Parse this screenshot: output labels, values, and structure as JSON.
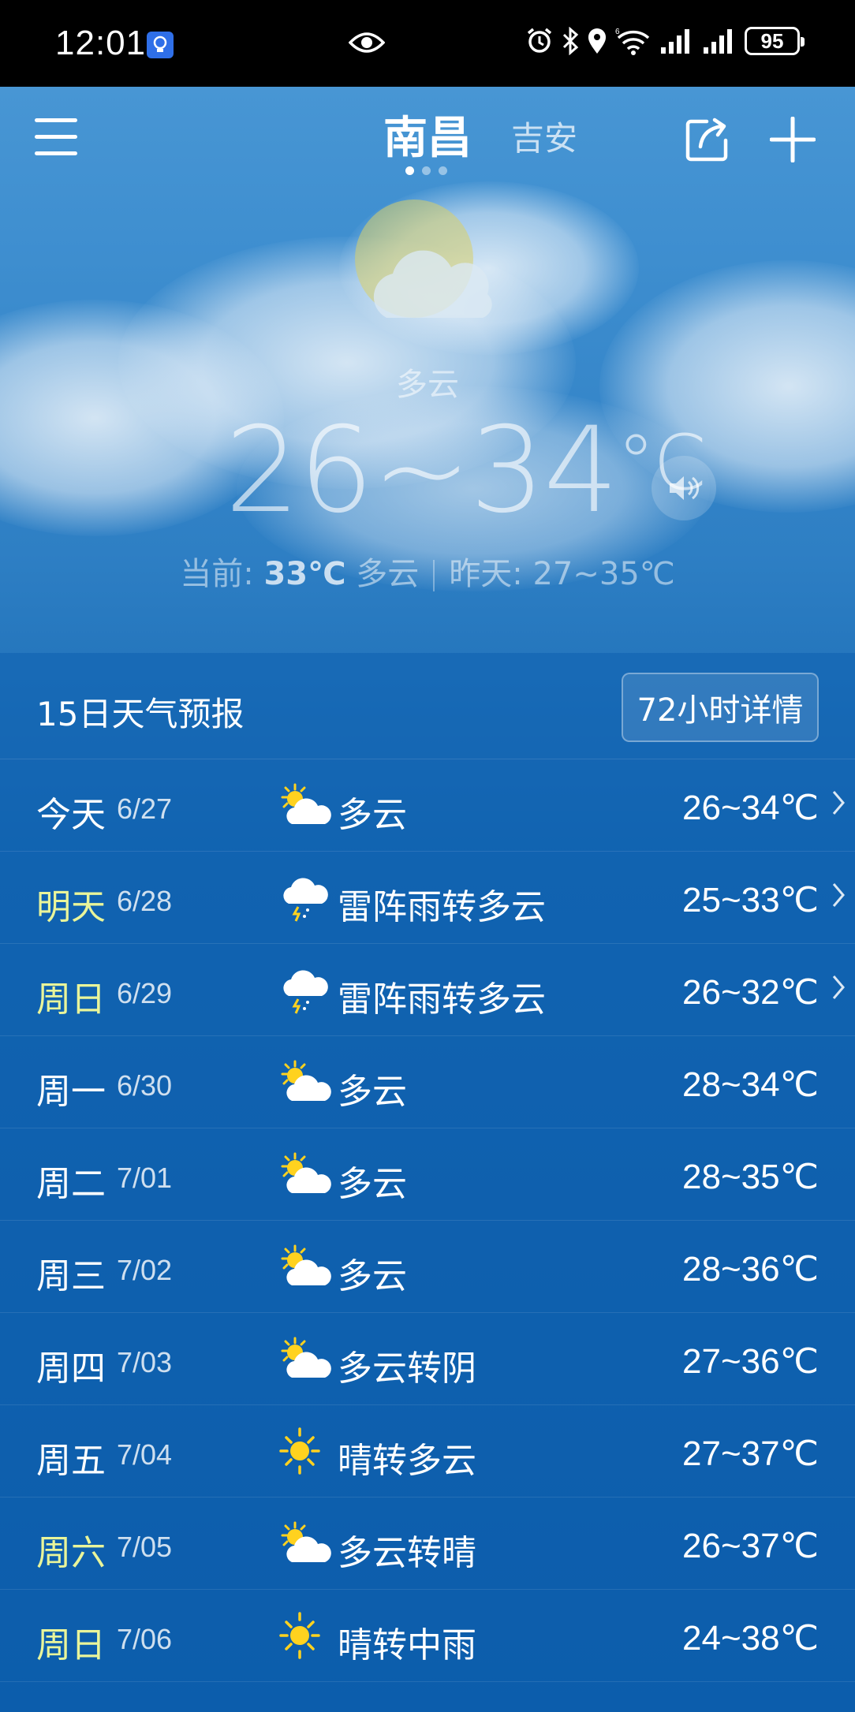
{
  "status_bar": {
    "time": "12:01",
    "battery": "95",
    "icons": [
      "bulb-icon",
      "eye-icon",
      "alarm-icon",
      "bluetooth-icon",
      "location-icon",
      "wifi-icon",
      "signal-icon",
      "signal-icon",
      "battery-icon"
    ]
  },
  "nav": {
    "city_current": "南昌",
    "city_other": "吉安",
    "page_dots": 3,
    "active_dot": 0
  },
  "current": {
    "condition": "多云",
    "temp_range": "26~34",
    "unit": "°C",
    "now_label": "当前:",
    "now_temp": "33℃",
    "now_condition": "多云",
    "yesterday": "昨天: 27~35℃"
  },
  "forecast": {
    "title": "15日天气预报",
    "detail_button": "72小时详情",
    "days": [
      {
        "day": "今天",
        "date": "6/27",
        "icon": "partly-cloudy-icon",
        "desc": "多云",
        "temp": "26~34℃",
        "highlight": false,
        "chevron": true
      },
      {
        "day": "明天",
        "date": "6/28",
        "icon": "thunderstorm-icon",
        "desc": "雷阵雨转多云",
        "temp": "25~33℃",
        "highlight": true,
        "chevron": true
      },
      {
        "day": "周日",
        "date": "6/29",
        "icon": "thunderstorm-icon",
        "desc": "雷阵雨转多云",
        "temp": "26~32℃",
        "highlight": true,
        "chevron": true
      },
      {
        "day": "周一",
        "date": "6/30",
        "icon": "partly-cloudy-icon",
        "desc": "多云",
        "temp": "28~34℃",
        "highlight": false,
        "chevron": false
      },
      {
        "day": "周二",
        "date": "7/01",
        "icon": "partly-cloudy-icon",
        "desc": "多云",
        "temp": "28~35℃",
        "highlight": false,
        "chevron": false
      },
      {
        "day": "周三",
        "date": "7/02",
        "icon": "partly-cloudy-icon",
        "desc": "多云",
        "temp": "28~36℃",
        "highlight": false,
        "chevron": false
      },
      {
        "day": "周四",
        "date": "7/03",
        "icon": "partly-cloudy-icon",
        "desc": "多云转阴",
        "temp": "27~36℃",
        "highlight": false,
        "chevron": false
      },
      {
        "day": "周五",
        "date": "7/04",
        "icon": "sun-icon",
        "desc": "晴转多云",
        "temp": "27~37℃",
        "highlight": false,
        "chevron": false
      },
      {
        "day": "周六",
        "date": "7/05",
        "icon": "partly-cloudy-icon",
        "desc": "多云转晴",
        "temp": "26~37℃",
        "highlight": true,
        "chevron": false
      },
      {
        "day": "周日",
        "date": "7/06",
        "icon": "sun-icon",
        "desc": "晴转中雨",
        "temp": "24~38℃",
        "highlight": true,
        "chevron": false
      }
    ]
  },
  "colors": {
    "weekend_highlight": "#e9f59a",
    "sun": "#ffd21f",
    "panel": "#0e60b0"
  }
}
